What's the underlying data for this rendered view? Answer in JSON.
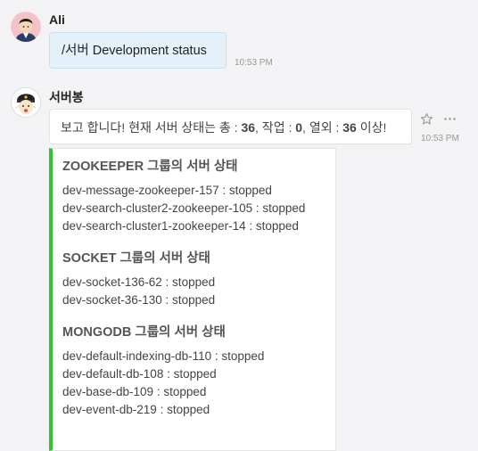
{
  "messages": [
    {
      "sender": "Ali",
      "text": "/서버 Development status",
      "time": "10:53 PM"
    },
    {
      "sender": "서버봉",
      "intro": {
        "prefix": "보고 합니다! 현재 서버 상태는 총 : ",
        "total": "36",
        "work_label": ", 작업 : ",
        "work": "0",
        "fault_label": ", 열외 : ",
        "fault": "36",
        "suffix": " 이상!"
      },
      "time": "10:53 PM",
      "sections": [
        {
          "title": "ZOOKEEPER 그룹의 서버 상태",
          "lines": [
            "dev-message-zookeeper-157 : stopped",
            "dev-search-cluster2-zookeeper-105 : stopped",
            "dev-search-cluster1-zookeeper-14 : stopped"
          ]
        },
        {
          "title": "SOCKET 그룹의 서버 상태",
          "lines": [
            "dev-socket-136-62 : stopped",
            "dev-socket-36-130 : stopped"
          ]
        },
        {
          "title": "MONGODB 그룹의 서버 상태",
          "lines": [
            "dev-default-indexing-db-110 : stopped",
            "dev-default-db-108 : stopped",
            "dev-base-db-109 : stopped",
            "dev-event-db-219 : stopped"
          ]
        }
      ]
    }
  ],
  "icons": {
    "star": "star-icon",
    "more": "more-icon"
  },
  "colors": {
    "accent_bar": "#2ec52e",
    "user_bubble": "#e4f1fb",
    "bot_bubble": "#ffffff"
  }
}
